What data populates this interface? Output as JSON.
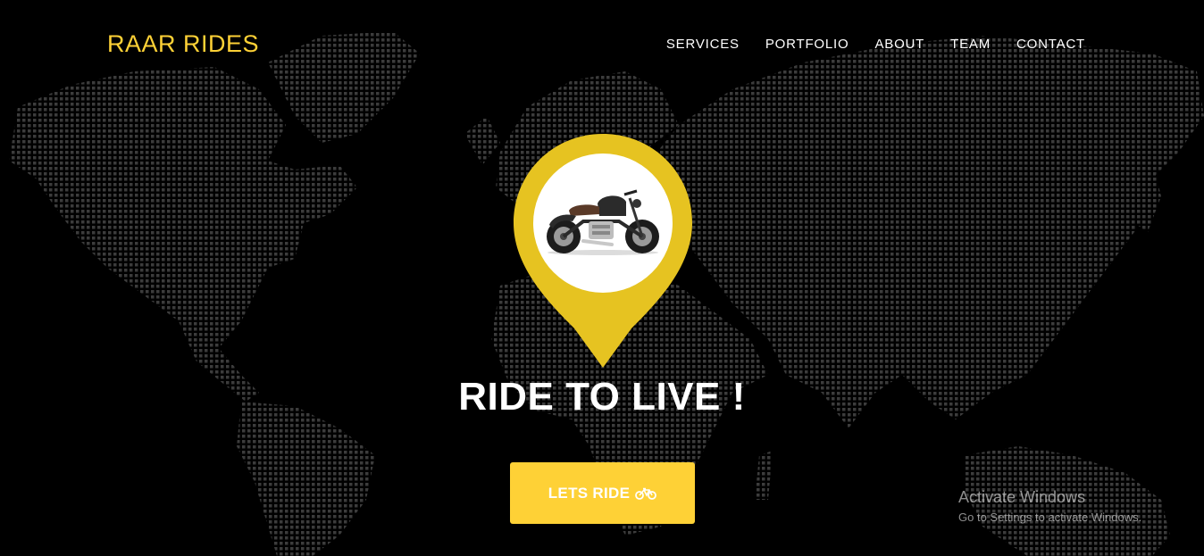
{
  "brand": {
    "name": "RAAR RIDES"
  },
  "nav": {
    "items": [
      {
        "label": "SERVICES"
      },
      {
        "label": "PORTFOLIO"
      },
      {
        "label": "ABOUT"
      },
      {
        "label": "TEAM"
      },
      {
        "label": "CONTACT"
      }
    ]
  },
  "hero": {
    "heading": "RIDE TO LIVE !",
    "cta_label": "LETS RIDE",
    "cta_icon": "bicycle-icon",
    "pin_icon": "motorcycle-icon"
  },
  "watermark": {
    "title": "Activate Windows",
    "subtitle": "Go to Settings to activate Windows."
  },
  "colors": {
    "accent": "#fed136",
    "pin": "#e6c321",
    "background": "#000000",
    "map_dots": "#3a3a3a"
  }
}
